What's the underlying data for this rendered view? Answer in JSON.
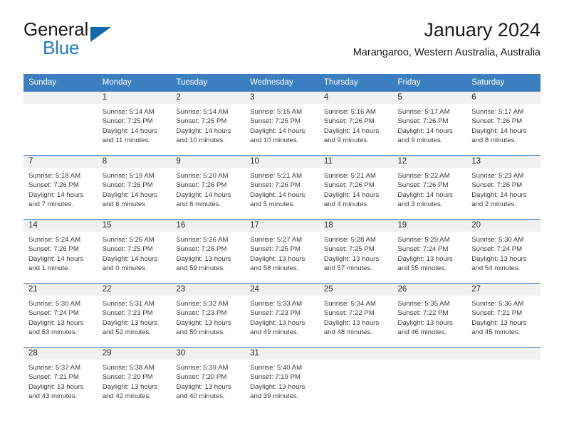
{
  "brand": {
    "name_part1": "General",
    "name_part2": "Blue",
    "logo_icon": "triangle-logo-icon"
  },
  "header": {
    "title": "January 2024",
    "subtitle": "Marangaroo, Western Australia, Australia"
  },
  "theme": {
    "header_blue": "#3c7fc1",
    "brand_blue": "#1d7cc4",
    "daynum_band": "#f0f0f0",
    "text": "#3a3a3a"
  },
  "calendar": {
    "weekday_headers": [
      "Sunday",
      "Monday",
      "Tuesday",
      "Wednesday",
      "Thursday",
      "Friday",
      "Saturday"
    ],
    "weeks": [
      [
        {
          "day": "",
          "empty": true,
          "lines": []
        },
        {
          "day": "1",
          "lines": [
            "Sunrise: 5:14 AM",
            "Sunset: 7:25 PM",
            "Daylight: 14 hours",
            "and 11 minutes."
          ]
        },
        {
          "day": "2",
          "lines": [
            "Sunrise: 5:14 AM",
            "Sunset: 7:25 PM",
            "Daylight: 14 hours",
            "and 10 minutes."
          ]
        },
        {
          "day": "3",
          "lines": [
            "Sunrise: 5:15 AM",
            "Sunset: 7:25 PM",
            "Daylight: 14 hours",
            "and 10 minutes."
          ]
        },
        {
          "day": "4",
          "lines": [
            "Sunrise: 5:16 AM",
            "Sunset: 7:26 PM",
            "Daylight: 14 hours",
            "and 9 minutes."
          ]
        },
        {
          "day": "5",
          "lines": [
            "Sunrise: 5:17 AM",
            "Sunset: 7:26 PM",
            "Daylight: 14 hours",
            "and 9 minutes."
          ]
        },
        {
          "day": "6",
          "lines": [
            "Sunrise: 5:17 AM",
            "Sunset: 7:26 PM",
            "Daylight: 14 hours",
            "and 8 minutes."
          ]
        }
      ],
      [
        {
          "day": "7",
          "lines": [
            "Sunrise: 5:18 AM",
            "Sunset: 7:26 PM",
            "Daylight: 14 hours",
            "and 7 minutes."
          ]
        },
        {
          "day": "8",
          "lines": [
            "Sunrise: 5:19 AM",
            "Sunset: 7:26 PM",
            "Daylight: 14 hours",
            "and 6 minutes."
          ]
        },
        {
          "day": "9",
          "lines": [
            "Sunrise: 5:20 AM",
            "Sunset: 7:26 PM",
            "Daylight: 14 hours",
            "and 6 minutes."
          ]
        },
        {
          "day": "10",
          "lines": [
            "Sunrise: 5:21 AM",
            "Sunset: 7:26 PM",
            "Daylight: 14 hours",
            "and 5 minutes."
          ]
        },
        {
          "day": "11",
          "lines": [
            "Sunrise: 5:21 AM",
            "Sunset: 7:26 PM",
            "Daylight: 14 hours",
            "and 4 minutes."
          ]
        },
        {
          "day": "12",
          "lines": [
            "Sunrise: 5:22 AM",
            "Sunset: 7:26 PM",
            "Daylight: 14 hours",
            "and 3 minutes."
          ]
        },
        {
          "day": "13",
          "lines": [
            "Sunrise: 5:23 AM",
            "Sunset: 7:26 PM",
            "Daylight: 14 hours",
            "and 2 minutes."
          ]
        }
      ],
      [
        {
          "day": "14",
          "lines": [
            "Sunrise: 5:24 AM",
            "Sunset: 7:26 PM",
            "Daylight: 14 hours",
            "and 1 minute."
          ]
        },
        {
          "day": "15",
          "lines": [
            "Sunrise: 5:25 AM",
            "Sunset: 7:25 PM",
            "Daylight: 14 hours",
            "and 0 minutes."
          ]
        },
        {
          "day": "16",
          "lines": [
            "Sunrise: 5:26 AM",
            "Sunset: 7:25 PM",
            "Daylight: 13 hours",
            "and 59 minutes."
          ]
        },
        {
          "day": "17",
          "lines": [
            "Sunrise: 5:27 AM",
            "Sunset: 7:25 PM",
            "Daylight: 13 hours",
            "and 58 minutes."
          ]
        },
        {
          "day": "18",
          "lines": [
            "Sunrise: 5:28 AM",
            "Sunset: 7:25 PM",
            "Daylight: 13 hours",
            "and 57 minutes."
          ]
        },
        {
          "day": "19",
          "lines": [
            "Sunrise: 5:29 AM",
            "Sunset: 7:24 PM",
            "Daylight: 13 hours",
            "and 55 minutes."
          ]
        },
        {
          "day": "20",
          "lines": [
            "Sunrise: 5:30 AM",
            "Sunset: 7:24 PM",
            "Daylight: 13 hours",
            "and 54 minutes."
          ]
        }
      ],
      [
        {
          "day": "21",
          "lines": [
            "Sunrise: 5:30 AM",
            "Sunset: 7:24 PM",
            "Daylight: 13 hours",
            "and 53 minutes."
          ]
        },
        {
          "day": "22",
          "lines": [
            "Sunrise: 5:31 AM",
            "Sunset: 7:23 PM",
            "Daylight: 13 hours",
            "and 52 minutes."
          ]
        },
        {
          "day": "23",
          "lines": [
            "Sunrise: 5:32 AM",
            "Sunset: 7:23 PM",
            "Daylight: 13 hours",
            "and 50 minutes."
          ]
        },
        {
          "day": "24",
          "lines": [
            "Sunrise: 5:33 AM",
            "Sunset: 7:23 PM",
            "Daylight: 13 hours",
            "and 49 minutes."
          ]
        },
        {
          "day": "25",
          "lines": [
            "Sunrise: 5:34 AM",
            "Sunset: 7:22 PM",
            "Daylight: 13 hours",
            "and 48 minutes."
          ]
        },
        {
          "day": "26",
          "lines": [
            "Sunrise: 5:35 AM",
            "Sunset: 7:22 PM",
            "Daylight: 13 hours",
            "and 46 minutes."
          ]
        },
        {
          "day": "27",
          "lines": [
            "Sunrise: 5:36 AM",
            "Sunset: 7:21 PM",
            "Daylight: 13 hours",
            "and 45 minutes."
          ]
        }
      ],
      [
        {
          "day": "28",
          "lines": [
            "Sunrise: 5:37 AM",
            "Sunset: 7:21 PM",
            "Daylight: 13 hours",
            "and 43 minutes."
          ]
        },
        {
          "day": "29",
          "lines": [
            "Sunrise: 5:38 AM",
            "Sunset: 7:20 PM",
            "Daylight: 13 hours",
            "and 42 minutes."
          ]
        },
        {
          "day": "30",
          "lines": [
            "Sunrise: 5:39 AM",
            "Sunset: 7:20 PM",
            "Daylight: 13 hours",
            "and 40 minutes."
          ]
        },
        {
          "day": "31",
          "lines": [
            "Sunrise: 5:40 AM",
            "Sunset: 7:19 PM",
            "Daylight: 13 hours",
            "and 39 minutes."
          ]
        },
        {
          "day": "",
          "empty": true,
          "lines": []
        },
        {
          "day": "",
          "empty": true,
          "lines": []
        },
        {
          "day": "",
          "empty": true,
          "lines": []
        }
      ]
    ]
  }
}
